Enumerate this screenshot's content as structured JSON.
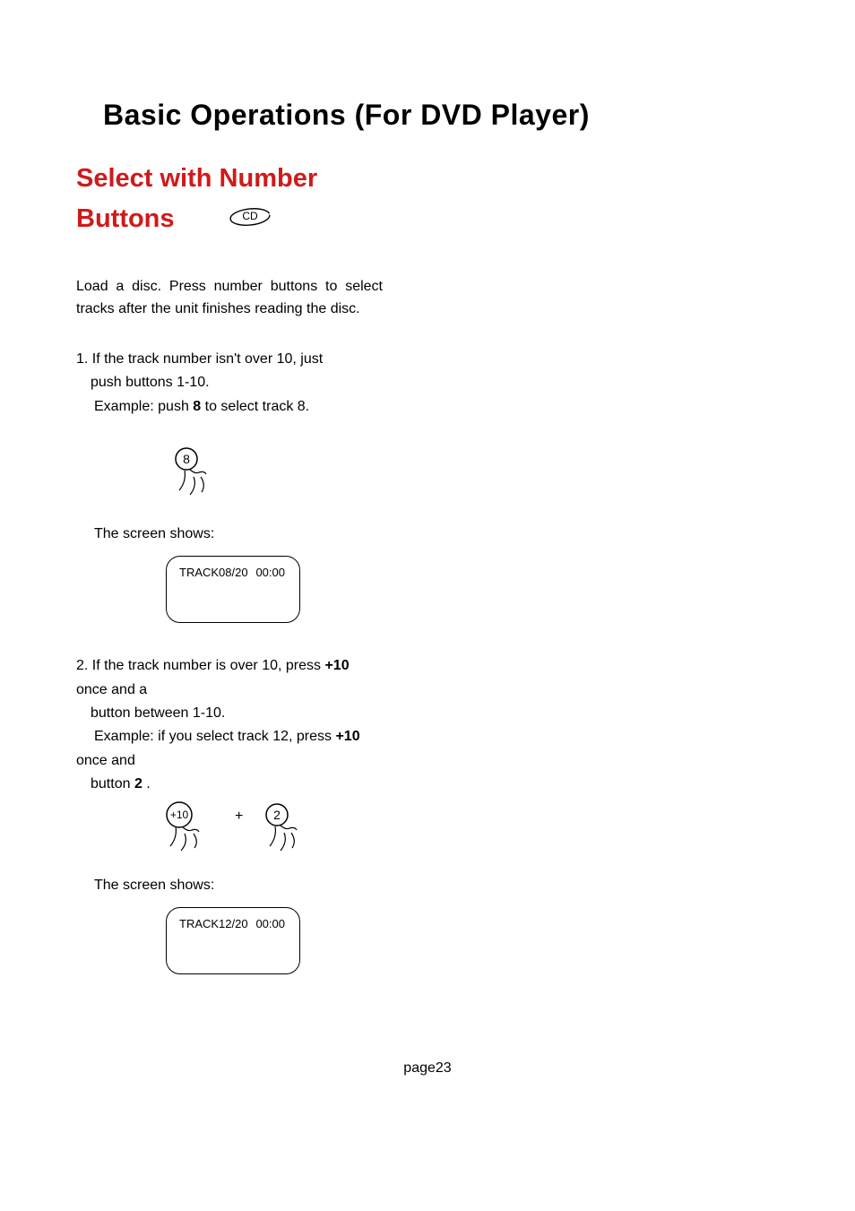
{
  "chapter_title": "Basic Operations (For DVD Player)",
  "section_title_line1": "Select with Number",
  "section_title_line2": "Buttons",
  "cd_badge": "CD",
  "intro": "Load a disc. Press number buttons to select tracks after the unit finishes reading the disc.",
  "step1": {
    "line1": "1. If the track number isn't over 10, just",
    "line2": "push buttons 1-10.",
    "line3a": "Example: push ",
    "line3b": "8",
    "line3c": " to select track 8.",
    "button_label": "8",
    "screen_shows": "The screen shows:",
    "display_left": "TRACK08/20",
    "display_right": "00:00"
  },
  "step2": {
    "line1a": "2. If the track number is over 10, press  ",
    "line1b": "+10",
    "line1c": " once and a",
    "line2": "button between 1-10.",
    "line3a": "Example: if you select track 12, press ",
    "line3b": "+10",
    "line3c": " once and",
    "line4a": "button ",
    "line4b": "2",
    "line4c": " .",
    "button1_label": "+10",
    "plus": "+",
    "button2_label": "2",
    "screen_shows": "The screen shows:",
    "display_left": "TRACK12/20",
    "display_right": "00:00"
  },
  "footer": "page23"
}
